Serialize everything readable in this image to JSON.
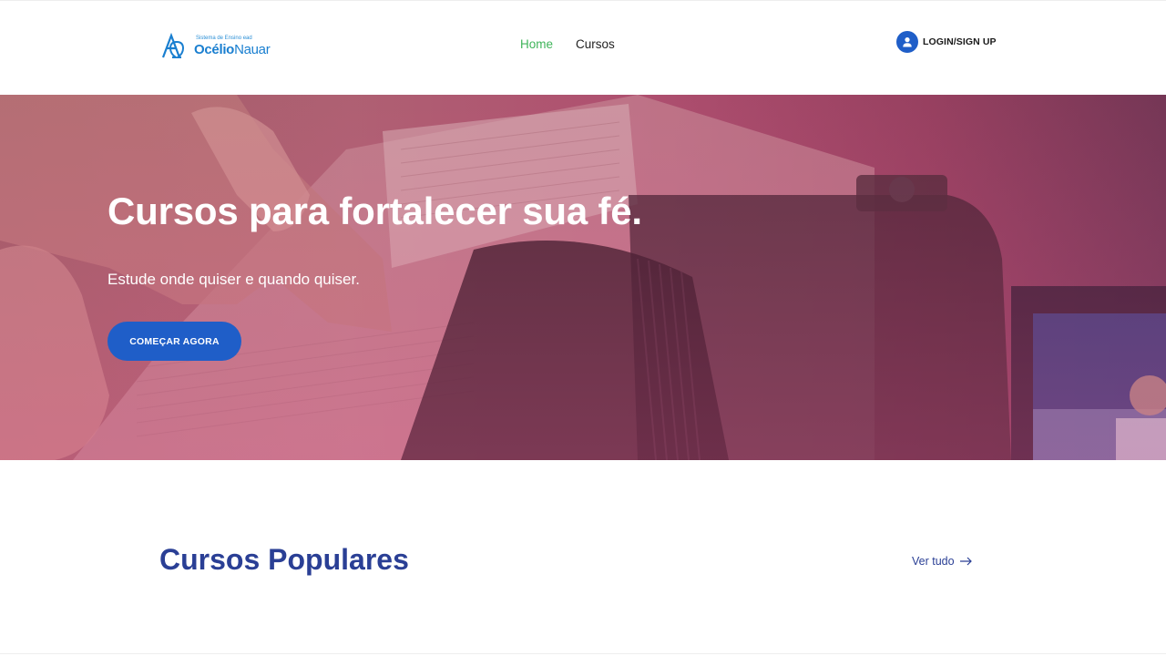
{
  "brand": {
    "tagline": "Sistema de Ensino ead",
    "name_bold": "Océlio",
    "name_light": "Nauar",
    "color": "#1a7fd0"
  },
  "nav": {
    "items": [
      {
        "label": "Home",
        "active": true
      },
      {
        "label": "Cursos",
        "active": false
      }
    ],
    "active_color": "#3fb45a"
  },
  "account": {
    "icon": "user-icon",
    "label": "LOGIN/SIGN UP"
  },
  "hero": {
    "title": "Cursos para fortalecer sua fé.",
    "subtitle": "Estude onde quiser e quando quiser.",
    "cta_label": "COMEÇAR AGORA",
    "accent": "#1f5ec8"
  },
  "popular": {
    "title": "Cursos Populares",
    "see_all_label": "Ver tudo",
    "see_all_icon": "arrow-right-icon",
    "title_color": "#2a3f95"
  }
}
